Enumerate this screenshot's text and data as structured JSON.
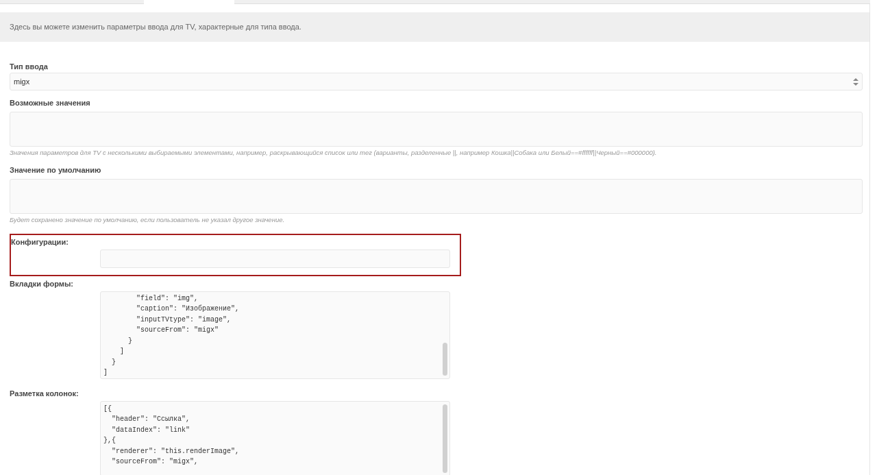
{
  "description": "Здесь вы можете изменить параметры ввода для TV, характерные для типа ввода.",
  "input_type": {
    "label": "Тип ввода",
    "value": "migx"
  },
  "fields": [
    {
      "label": "Возможные значения",
      "help": "Значения параметров для TV с несколькими выбираемыми элементами, например, раскрывающийся список или тег (варианты, разделенные ||, например Кошка||Собака или Белый==#ffffff||Черный==#000000)."
    },
    {
      "label": "Значение по умолчанию",
      "help": "Будет сохранено значение по умолчанию, если пользователь не указал другое значение."
    }
  ],
  "configs": {
    "label": "Конфигурации:",
    "highlighted": true
  },
  "code_fields": [
    {
      "label": "Вкладки формы:",
      "lines": [
        "        \"field\": \"img\",",
        "        \"caption\": \"Изображение\",",
        "        \"inputTVtype\": \"image\",",
        "        \"sourceFrom\": \"migx\"",
        "      }",
        "    ]",
        "  }",
        "]"
      ]
    },
    {
      "label": "Разметка колонок:",
      "lines": [
        "[{",
        "  \"header\": \"Ссылка\",",
        "  \"dataIndex\": \"link\"",
        "},{",
        "  \"renderer\": \"this.renderImage\",",
        "  \"sourceFrom\": \"migx\","
      ]
    }
  ]
}
